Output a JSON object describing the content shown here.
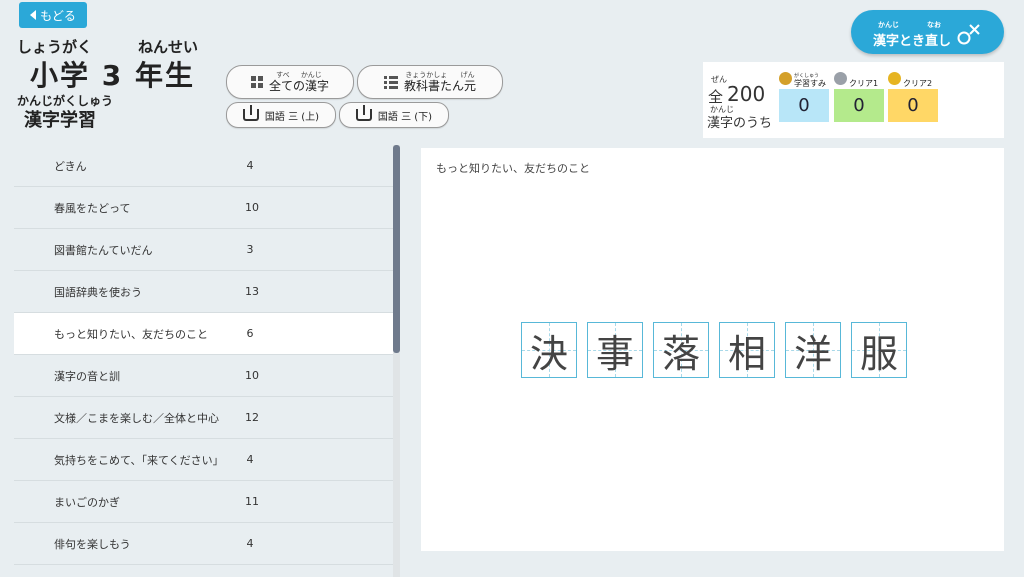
{
  "header": {
    "back_label": "もどる",
    "grade_ruby": "しょうがく",
    "year_ruby": "ねんせい",
    "grade_title": "小学 3 年生",
    "study_ruby": "かんじがくしゅう",
    "study_title": "漢字学習"
  },
  "filters": {
    "all_kanji": {
      "ruby_a": "すべ",
      "ruby_b": "かんじ",
      "label": "全ての漢字"
    },
    "textbook": {
      "ruby_a": "きょうかしょ",
      "ruby_b": "げん",
      "label": "教科書たん元"
    },
    "book1": "国語 三 (上)",
    "book2": "国語 三 (下)"
  },
  "retry": {
    "ruby_a": "かんじ",
    "ruby_b": "なお",
    "label": "漢字とき直し"
  },
  "stats": {
    "zen_ruby": "ぜん",
    "total_label": "全",
    "total": "200",
    "kanji_ruby": "かんじ",
    "uchi_label": "漢字のうち",
    "studied_ruby": "がくしゅう",
    "studied_label": "学習すみ",
    "studied_value": "0",
    "clear1_label": "クリア1",
    "clear1_value": "0",
    "clear2_label": "クリア2",
    "clear2_value": "0",
    "colors": {
      "studied": "#b8e6f8",
      "clear1": "#b4ea8c",
      "clear2": "#ffd766",
      "accent": "#2ba8d8"
    }
  },
  "units": [
    {
      "name": "どきん",
      "count": "4"
    },
    {
      "name": "春風をたどって",
      "count": "10"
    },
    {
      "name": "図書館たんていだん",
      "count": "3"
    },
    {
      "name": "国語辞典を使おう",
      "count": "13"
    },
    {
      "name": "もっと知りたい、友だちのこと",
      "count": "6"
    },
    {
      "name": "漢字の音と訓",
      "count": "10"
    },
    {
      "name": "文様／こまを楽しむ／全体と中心",
      "count": "12"
    },
    {
      "name": "気持ちをこめて、「来てください」",
      "count": "4"
    },
    {
      "name": "まいごのかぎ",
      "count": "11"
    },
    {
      "name": "俳句を楽しもう",
      "count": "4"
    }
  ],
  "selected_unit": {
    "title": "もっと知りたい、友だちのこと",
    "kanji": [
      "決",
      "事",
      "落",
      "相",
      "洋",
      "服"
    ]
  }
}
